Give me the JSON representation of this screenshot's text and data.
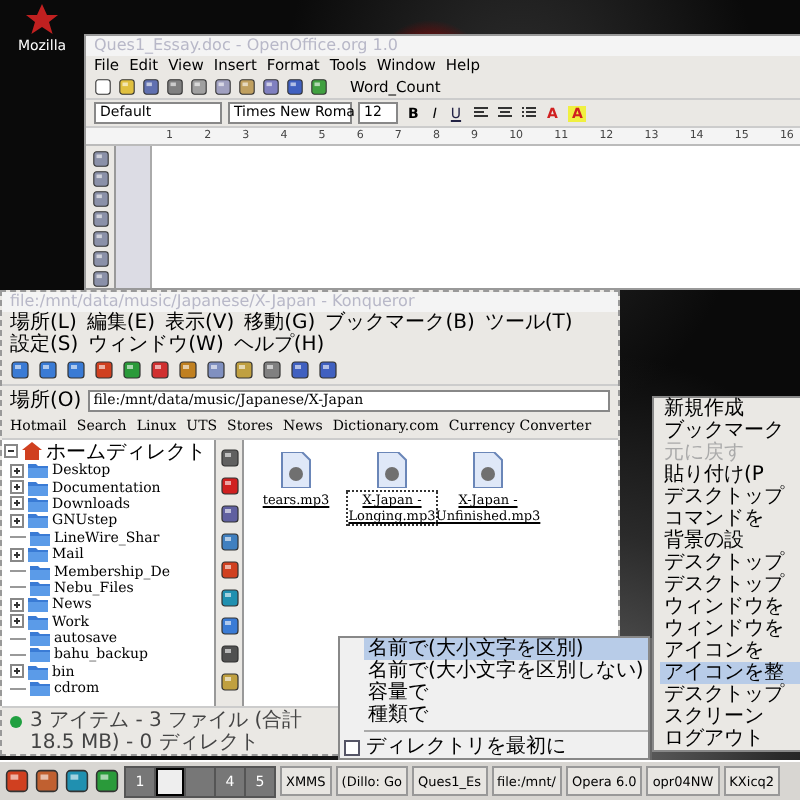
{
  "desktop_icons": [
    {
      "label": "Mozilla"
    }
  ],
  "writer_window": {
    "title": "Ques1_Essay.doc - OpenOffice.org 1.0",
    "menu": [
      "File",
      "Edit",
      "View",
      "Insert",
      "Format",
      "Tools",
      "Window",
      "Help"
    ],
    "toolbar_button": "Word_Count",
    "paragraph_style": "Default",
    "font_name": "Times New Roma",
    "font_size": "12",
    "format_buttons": [
      "B",
      "I",
      "U"
    ],
    "color_buttons": [
      "A",
      "A"
    ],
    "ruler_numbers": [
      "1",
      "2",
      "3",
      "4",
      "5",
      "6",
      "7",
      "8",
      "9",
      "10",
      "11",
      "12",
      "13",
      "14",
      "15",
      "16"
    ]
  },
  "file_manager": {
    "title": "file:/mnt/data/music/Japanese/X-Japan - Konqueror",
    "menu": [
      "場所(L)",
      "編集(E)",
      "表示(V)",
      "移動(G)",
      "ブックマーク(B)",
      "ツール(T)",
      "設定(S)",
      "ウィンドウ(W)",
      "ヘルプ(H)"
    ],
    "location_label": "場所(O)",
    "location": "file:/mnt/data/music/Japanese/X-Japan",
    "bookmarks": [
      "Hotmail",
      "Search",
      "Linux",
      "UTS",
      "Stores",
      "News",
      "Dictionary.com",
      "Currency Converter"
    ],
    "tree": {
      "label": "ホームディレクト",
      "expanded": true,
      "children": [
        {
          "label": "Desktop",
          "expandable": true
        },
        {
          "label": "Documentation",
          "expandable": true
        },
        {
          "label": "Downloads",
          "expandable": true
        },
        {
          "label": "GNUstep",
          "expandable": true
        },
        {
          "label": "LineWire_Shar",
          "expandable": false
        },
        {
          "label": "Mail",
          "expandable": true
        },
        {
          "label": "Membership_De",
          "expandable": false
        },
        {
          "label": "Nebu_Files",
          "expandable": false
        },
        {
          "label": "News",
          "expandable": true
        },
        {
          "label": "Work",
          "expandable": true
        },
        {
          "label": "autosave",
          "expandable": false
        },
        {
          "label": "bahu_backup",
          "expandable": false
        },
        {
          "label": "bin",
          "expandable": true
        },
        {
          "label": "cdrom",
          "expandable": false
        }
      ]
    },
    "files": [
      {
        "name": "tears.mp3",
        "selected": false
      },
      {
        "name": "X-Japan - Longing.mp3",
        "selected": true
      },
      {
        "name": "X-Japan - Unfinished.mp3",
        "selected": false
      }
    ],
    "status": "3 アイテム - 3 ファイル (合計 18.5 MB) - 0 ディレクト"
  },
  "context_menu": {
    "items": [
      {
        "label": "新規作成",
        "disabled": false,
        "selected": false
      },
      {
        "label": "ブックマーク",
        "disabled": false,
        "selected": false
      },
      {
        "label": "元に戻す",
        "disabled": true,
        "selected": false
      },
      {
        "label": "貼り付け(P",
        "disabled": false,
        "selected": false
      },
      {
        "label": "デスクトップ",
        "disabled": false,
        "selected": false
      },
      {
        "label": "コマンドを",
        "disabled": false,
        "selected": false
      },
      {
        "label": "背景の設",
        "disabled": false,
        "selected": false
      },
      {
        "label": "デスクトップ",
        "disabled": false,
        "selected": false
      },
      {
        "label": "デスクトップ",
        "disabled": false,
        "selected": false
      },
      {
        "label": "ウィンドウを",
        "disabled": false,
        "selected": false
      },
      {
        "label": "ウィンドウを",
        "disabled": false,
        "selected": false
      },
      {
        "label": "アイコンを",
        "disabled": false,
        "selected": false
      },
      {
        "label": "アイコンを整",
        "disabled": false,
        "selected": true
      },
      {
        "label": "デスクトップ",
        "disabled": false,
        "selected": false
      },
      {
        "label": "スクリーン",
        "disabled": false,
        "selected": false
      },
      {
        "label": "ログアウト",
        "disabled": false,
        "selected": false
      }
    ]
  },
  "sort_submenu": {
    "items": [
      {
        "kind": "option",
        "label": "名前で(大小文字を区別)",
        "selected": true
      },
      {
        "kind": "option",
        "label": "名前で(大小文字を区別しない)",
        "selected": false
      },
      {
        "kind": "option",
        "label": "容量で",
        "selected": false
      },
      {
        "kind": "option",
        "label": "種類で",
        "selected": false
      },
      {
        "kind": "check",
        "label": "ディレクトリを最初に",
        "checked": false
      }
    ]
  },
  "taskbar": {
    "desktops": [
      {
        "label": "1",
        "selected": false
      },
      {
        "selected": true
      },
      {
        "selected": false
      },
      {
        "label": "4",
        "selected": false
      },
      {
        "label": "5",
        "selected": false
      }
    ],
    "tasks": [
      "XMMS",
      "(Dillo: Go",
      "Ques1_Es",
      "file:/mnt/",
      "Opera 6.0",
      "opr04NW",
      "KXicq2"
    ]
  }
}
